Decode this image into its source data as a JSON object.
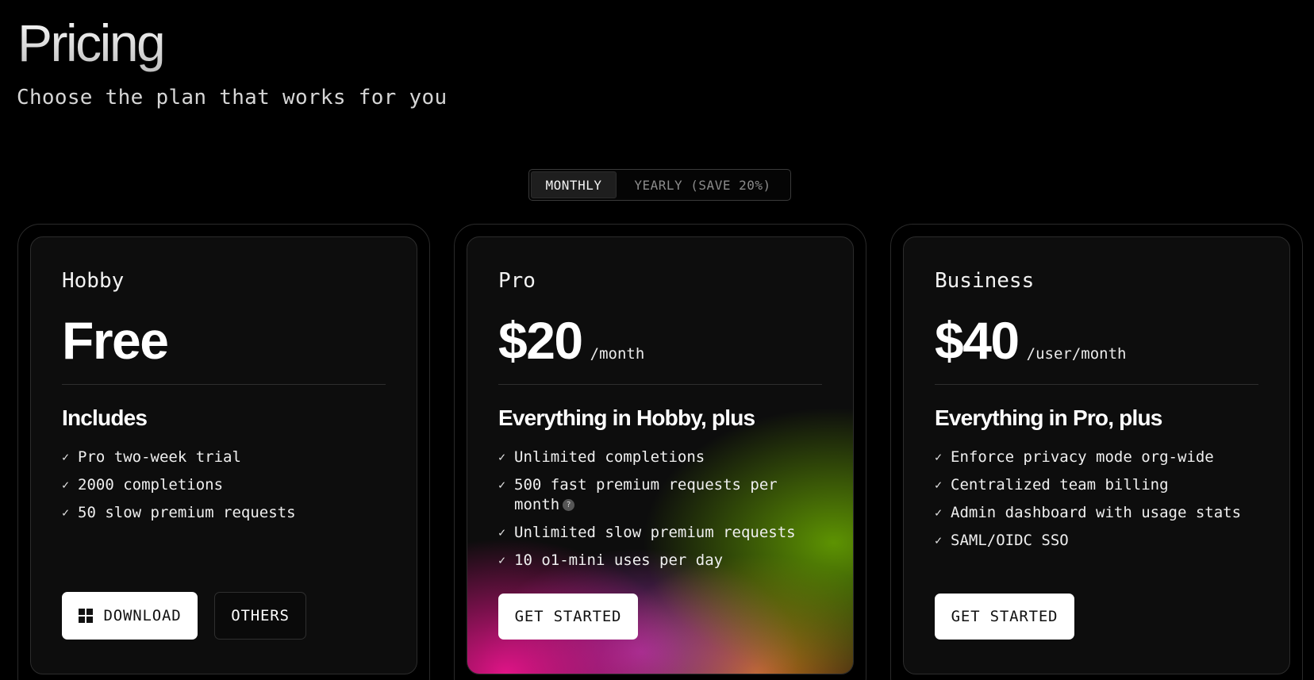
{
  "header": {
    "title": "Pricing",
    "subtitle": "Choose the plan that works for you"
  },
  "billing_toggle": {
    "monthly_label": "MONTHLY",
    "yearly_label": "YEARLY (SAVE 20%)",
    "selected": "MONTHLY"
  },
  "plans": [
    {
      "name": "Hobby",
      "price": "Free",
      "unit": "",
      "includes_heading": "Includes",
      "features": [
        "Pro two-week trial",
        "2000 completions",
        "50 slow premium requests"
      ],
      "buttons": [
        {
          "label": "DOWNLOAD",
          "icon": "windows-icon",
          "style": "light"
        },
        {
          "label": "OTHERS",
          "style": "dark"
        }
      ]
    },
    {
      "name": "Pro",
      "price": "$20",
      "unit": "/month",
      "includes_heading": "Everything in Hobby, plus",
      "features": [
        "Unlimited completions",
        "500 fast premium requests per month",
        "Unlimited slow premium requests",
        "10 o1-mini uses per day"
      ],
      "feature_help_icon": "?",
      "buttons": [
        {
          "label": "GET STARTED",
          "style": "light"
        }
      ]
    },
    {
      "name": "Business",
      "price": "$40",
      "unit": "/user/month",
      "includes_heading": "Everything in Pro, plus",
      "features": [
        "Enforce privacy mode org-wide",
        "Centralized team billing",
        "Admin dashboard with usage stats",
        "SAML/OIDC SSO"
      ],
      "buttons": [
        {
          "label": "GET STARTED",
          "style": "light"
        }
      ]
    }
  ],
  "check_glyph": "✓",
  "colors": {
    "background": "#000000",
    "card": "#0d0d0d",
    "pro_glow": [
      "#e9148c",
      "#6baa00",
      "#dc821e",
      "#be3cc8"
    ]
  }
}
